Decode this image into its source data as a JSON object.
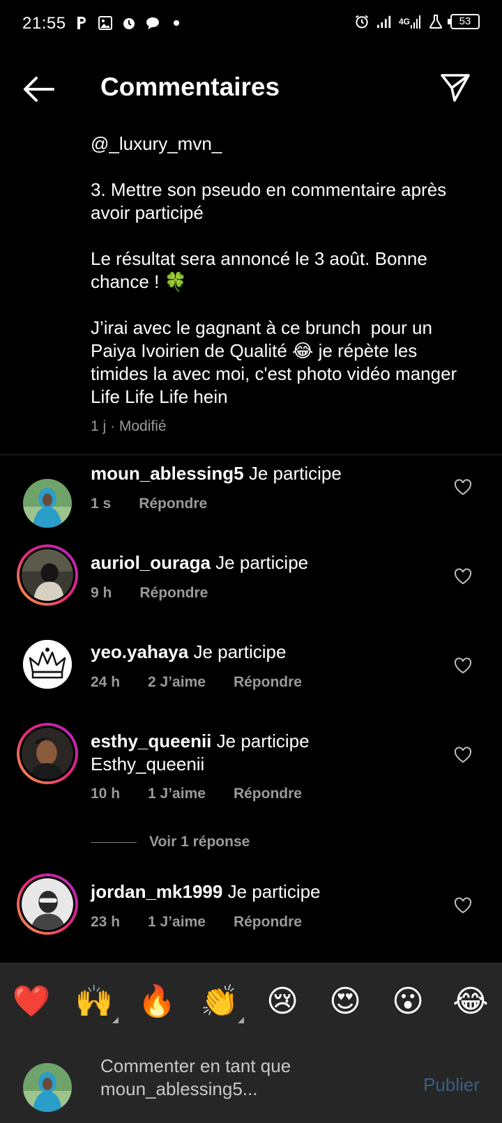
{
  "status_bar": {
    "time": "21:55",
    "battery": "53",
    "network": "4G",
    "icons": [
      "parking-icon",
      "photo-icon",
      "alarm-icon",
      "chat-bubble-icon",
      "dot-icon",
      "alarm-icon",
      "signal-icon",
      "signal-4g-icon",
      "lab-flask-icon",
      "battery-icon"
    ]
  },
  "header": {
    "title": "Commentaires",
    "back_icon": "arrow-left-icon",
    "share_icon": "send-icon"
  },
  "caption": {
    "mention": "@_luxury_mvn_",
    "paragraphs": [
      "3. Mettre son pseudo en commentaire après avoir participé",
      "Le résultat sera annoncé le 3 août. Bonne chance ! 🍀",
      "J’irai avec le gagnant à ce brunch  pour un Paiya Ivoirien de Qualité 😂 je répète les timides la avec moi, c'est photo vidéo manger Life Life Life hein"
    ],
    "time": "1 j",
    "edited": "Modifié"
  },
  "comments": [
    {
      "username": "moun_ablessing5",
      "text": "Je participe",
      "time": "1 s",
      "likes": "",
      "reply": "Répondre",
      "story_ring": false
    },
    {
      "username": "auriol_ouraga",
      "text": "Je participe",
      "time": "9 h",
      "likes": "",
      "reply": "Répondre",
      "story_ring": true
    },
    {
      "username": "yeo.yahaya",
      "text": "Je participe",
      "time": "24 h",
      "likes": "2 J’aime",
      "reply": "Répondre",
      "story_ring": false
    },
    {
      "username": "esthy_queenii",
      "text": "Je participe Esthy_queenii",
      "time": "10 h",
      "likes": "1 J’aime",
      "reply": "Répondre",
      "story_ring": true,
      "view_replies": "Voir 1 réponse"
    },
    {
      "username": "jordan_mk1999",
      "text": "Je participe",
      "time": "23 h",
      "likes": "1 J’aime",
      "reply": "Répondre",
      "story_ring": true
    }
  ],
  "emoji_bar": [
    "❤️",
    "🙌",
    "🔥",
    "👏",
    "😢",
    "😍",
    "😮",
    "😂"
  ],
  "compose": {
    "placeholder": "Commenter en tant que moun_ablessing5...",
    "publish": "Publier"
  },
  "colors": {
    "background": "#000000",
    "secondary_text": "#9a9a9a",
    "publish_disabled": "#3a5f86",
    "bottom_panel": "#262626"
  }
}
